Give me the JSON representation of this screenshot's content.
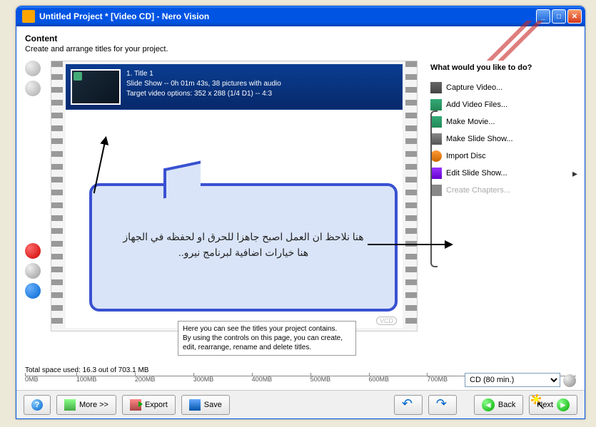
{
  "window": {
    "title": "Untitled Project * [Video CD] - Nero Vision"
  },
  "header": {
    "title": "Content",
    "subtitle": "Create and arrange titles for your project."
  },
  "title_item": {
    "name": "1. Title 1",
    "line2": "Slide Show -- 0h 01m 43s, 38 pictures with audio",
    "line3": "Target video options: 352 x 288 (1/4 D1) -- 4:3"
  },
  "right_panel": {
    "title": "What would you like to do?",
    "items": [
      {
        "label": "Capture Video..."
      },
      {
        "label": "Add Video Files..."
      },
      {
        "label": "Make Movie..."
      },
      {
        "label": "Make Slide Show..."
      },
      {
        "label": "Import Disc"
      },
      {
        "label": "Edit Slide Show..."
      },
      {
        "label": "Create Chapters..."
      }
    ]
  },
  "hint": {
    "line1": "Here you can see the titles your project contains.",
    "line2": "By using the controls on this page, you can create, edit, rearrange, rename and delete titles."
  },
  "space": "Total space used: 16.3 out of 703.1 MB",
  "ruler": [
    "0MB",
    "100MB",
    "200MB",
    "300MB",
    "400MB",
    "500MB",
    "600MB",
    "700MB"
  ],
  "cd_select": "CD (80 min.)",
  "buttons": {
    "more": "More >>",
    "export": "Export",
    "save": "Save",
    "back": "Back",
    "next": "Next"
  },
  "callout": {
    "line1": "هنا نلاحظ ان العمل اصبح جاهزا للحرق او لحفظه في الجهاز",
    "line2": "هنا خيارات اضافية لبرنامج نيرو.."
  },
  "vcd": "VCD"
}
